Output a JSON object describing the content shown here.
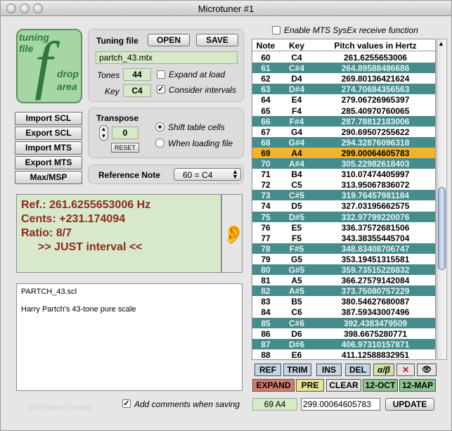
{
  "window": {
    "title": "Microtuner #1"
  },
  "tuning": {
    "logo_words": [
      "tuning",
      "file",
      "drop",
      "area"
    ],
    "logo_glyph": "f"
  },
  "tuning_file": {
    "heading": "Tuning file",
    "open_label": "OPEN",
    "save_label": "SAVE",
    "filename": "partch_43.mtx",
    "tones_label": "Tones",
    "tones_value": "44",
    "key_label": "Key",
    "key_value": "C4",
    "expand_label": "Expand at load",
    "expand_checked": false,
    "consider_label": "Consider intervals",
    "consider_checked": true
  },
  "side_buttons": [
    "Import SCL",
    "Export SCL",
    "Import MTS",
    "Export MTS",
    "Max/MSP"
  ],
  "transpose": {
    "heading": "Transpose",
    "value": "0",
    "reset_label": "RESET",
    "opt1": "Shift table cells",
    "opt2": "When loading file",
    "selected": "opt1"
  },
  "reference": {
    "label": "Reference Note",
    "value": "60 = C4"
  },
  "mts": {
    "label": "Enable MTS SysEx receive function",
    "checked": false
  },
  "info": {
    "ref": "Ref.: 261.6255653006 Hz",
    "cents": "Cents: +231.174094",
    "ratio": "Ratio: 8/7",
    "just": ">> JUST interval <<"
  },
  "notes": {
    "line1": "PARTCH_43.scl",
    "line2": "Harry Partch's 43-tone pure scale"
  },
  "table": {
    "headers": [
      "Note",
      "Key",
      "Pitch values in Hertz"
    ],
    "rows": [
      [
        "60",
        "C4",
        "261.6255653006"
      ],
      [
        "61",
        "C#4",
        "264.89588486686"
      ],
      [
        "62",
        "D4",
        "269.80136421624"
      ],
      [
        "63",
        "D#4",
        "274.70684356563"
      ],
      [
        "64",
        "E4",
        "279.06726965397"
      ],
      [
        "65",
        "F4",
        "285.40970760065"
      ],
      [
        "66",
        "F#4",
        "287.78812183006"
      ],
      [
        "67",
        "G4",
        "290.69507255622"
      ],
      [
        "68",
        "G#4",
        "294.32876096318"
      ],
      [
        "69",
        "A4",
        "299.00064605783"
      ],
      [
        "70",
        "A#4",
        "305.22982618403"
      ],
      [
        "71",
        "B4",
        "310.07474405997"
      ],
      [
        "72",
        "C5",
        "313.95067836072"
      ],
      [
        "73",
        "C#5",
        "319.76457981184"
      ],
      [
        "74",
        "D5",
        "327.03195662575"
      ],
      [
        "75",
        "D#5",
        "332.97799220076"
      ],
      [
        "76",
        "E5",
        "336.37572681506"
      ],
      [
        "77",
        "F5",
        "343.38355445704"
      ],
      [
        "78",
        "F#5",
        "348.83408706747"
      ],
      [
        "79",
        "G5",
        "353.19451315581"
      ],
      [
        "80",
        "G#5",
        "359.73515228832"
      ],
      [
        "81",
        "A5",
        "366.27579142084"
      ],
      [
        "82",
        "A#5",
        "373.75080757229"
      ],
      [
        "83",
        "B5",
        "380.54627680087"
      ],
      [
        "84",
        "C6",
        "387.59343007496"
      ],
      [
        "85",
        "C#6",
        "392.4383479509"
      ],
      [
        "86",
        "D6",
        "398.6675280771"
      ],
      [
        "87",
        "D#6",
        "406.97310157871"
      ],
      [
        "88",
        "E6",
        "411.12588832951"
      ]
    ],
    "row_styles": [
      "w",
      "t",
      "w",
      "t",
      "w",
      "w",
      "t",
      "w",
      "t",
      "y",
      "t",
      "w",
      "w",
      "t",
      "w",
      "t",
      "w",
      "w",
      "t",
      "w",
      "t",
      "w",
      "t",
      "w",
      "w",
      "t",
      "w",
      "t",
      "w"
    ]
  },
  "toolbar1": [
    "REF",
    "TRIM",
    "INS",
    "DEL",
    "α/β",
    "✕",
    "👁"
  ],
  "toolbar2": [
    "EXPAND",
    "PRE",
    "CLEAR",
    "12-OCT",
    "12-MAP"
  ],
  "footer": {
    "credit": "2005 Victor Cerullo",
    "comments_label": "Add comments when saving",
    "comments_checked": true,
    "selected_note": "69 A4",
    "pitch_value": "299.00064605783",
    "update_label": "UPDATE"
  },
  "colors": {
    "teal_row": "#468c8c",
    "highlight_row": "#f5b428",
    "info_text": "#8b2a1e",
    "green_field": "#d7e9c8"
  }
}
